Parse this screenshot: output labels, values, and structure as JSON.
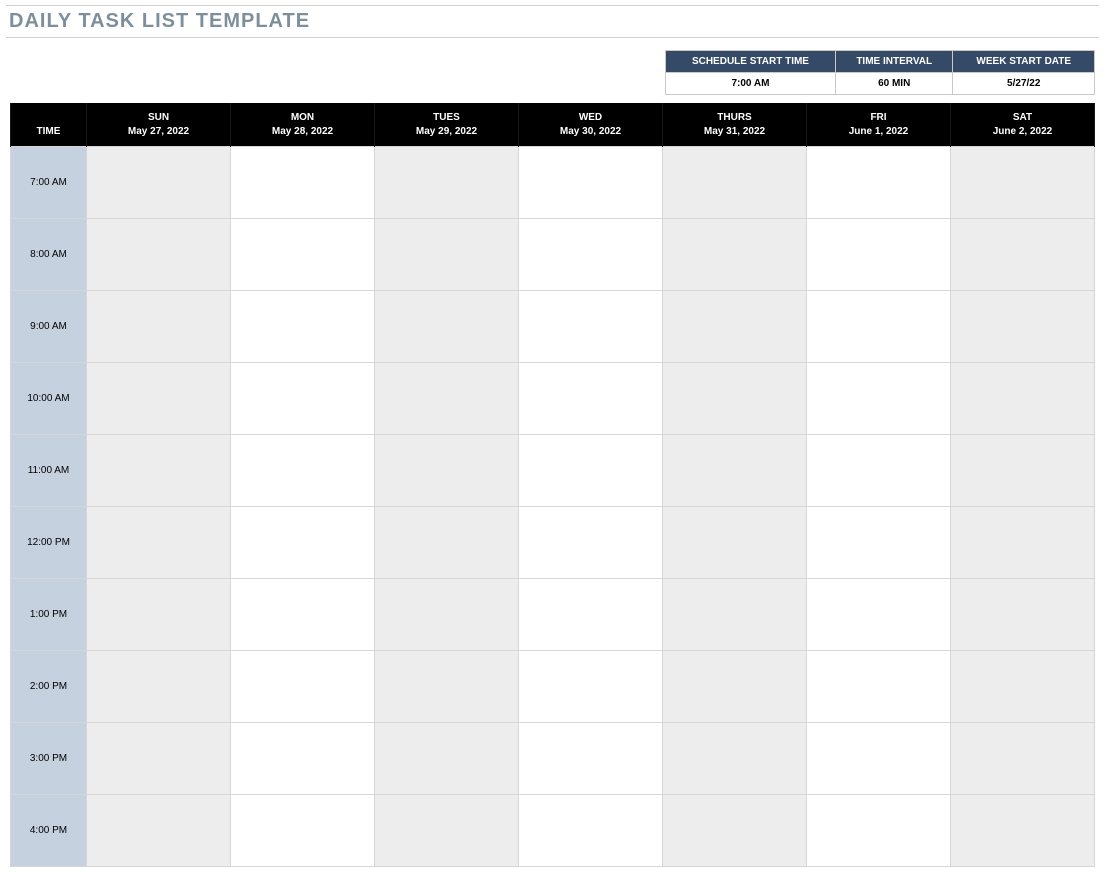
{
  "title": "DAILY TASK LIST TEMPLATE",
  "settings": {
    "headers": {
      "start": "SCHEDULE START TIME",
      "interval": "TIME INTERVAL",
      "weekstart": "WEEK START DATE"
    },
    "values": {
      "start": "7:00 AM",
      "interval": "60 MIN",
      "weekstart": "5/27/22"
    }
  },
  "schedule": {
    "time_header": "TIME",
    "days": [
      {
        "name": "SUN",
        "date": "May 27, 2022"
      },
      {
        "name": "MON",
        "date": "May 28, 2022"
      },
      {
        "name": "TUES",
        "date": "May 29, 2022"
      },
      {
        "name": "WED",
        "date": "May 30, 2022"
      },
      {
        "name": "THURS",
        "date": "May 31, 2022"
      },
      {
        "name": "FRI",
        "date": "June 1, 2022"
      },
      {
        "name": "SAT",
        "date": "June 2, 2022"
      }
    ],
    "times": [
      "7:00 AM",
      "8:00 AM",
      "9:00 AM",
      "10:00 AM",
      "11:00 AM",
      "12:00 PM",
      "1:00 PM",
      "2:00 PM",
      "3:00 PM",
      "4:00 PM"
    ]
  }
}
